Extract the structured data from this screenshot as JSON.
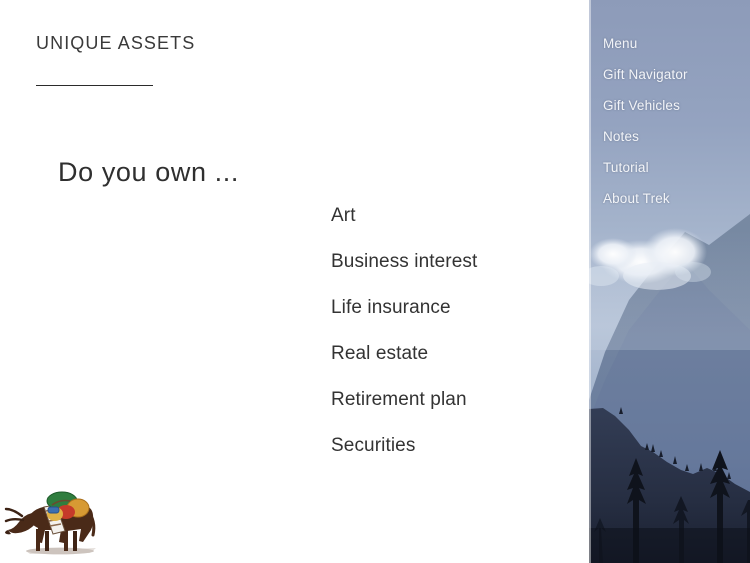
{
  "main": {
    "page_title": "UNIQUE ASSETS",
    "prompt": "Do you own ...",
    "assets": [
      {
        "label": "Art"
      },
      {
        "label": "Business interest"
      },
      {
        "label": "Life insurance"
      },
      {
        "label": "Real estate"
      },
      {
        "label": "Retirement plan"
      },
      {
        "label": "Securities"
      }
    ],
    "logo": {
      "icon": "pack-animal-logo",
      "alt": "Loaded pack yak carrying colored bundles"
    }
  },
  "sidebar": {
    "background_image": "mountain-sky-photo",
    "items": [
      {
        "label": "Menu"
      },
      {
        "label": "Gift Navigator"
      },
      {
        "label": "Gift Vehicles"
      },
      {
        "label": "Notes"
      },
      {
        "label": "Tutorial"
      },
      {
        "label": "About Trek"
      }
    ]
  },
  "colors": {
    "page_background": "#ffffff",
    "text_primary": "#333333",
    "rule": "#2b2b2b",
    "sidebar_sky_top": "#8e9cba",
    "sidebar_sky_mid": "#a8b6cd",
    "sidebar_mountain": "#6f7f9c",
    "sidebar_ridge": "#2c3346",
    "sidebar_trees": "#12161f",
    "menu_text": "#f2f4f8"
  }
}
